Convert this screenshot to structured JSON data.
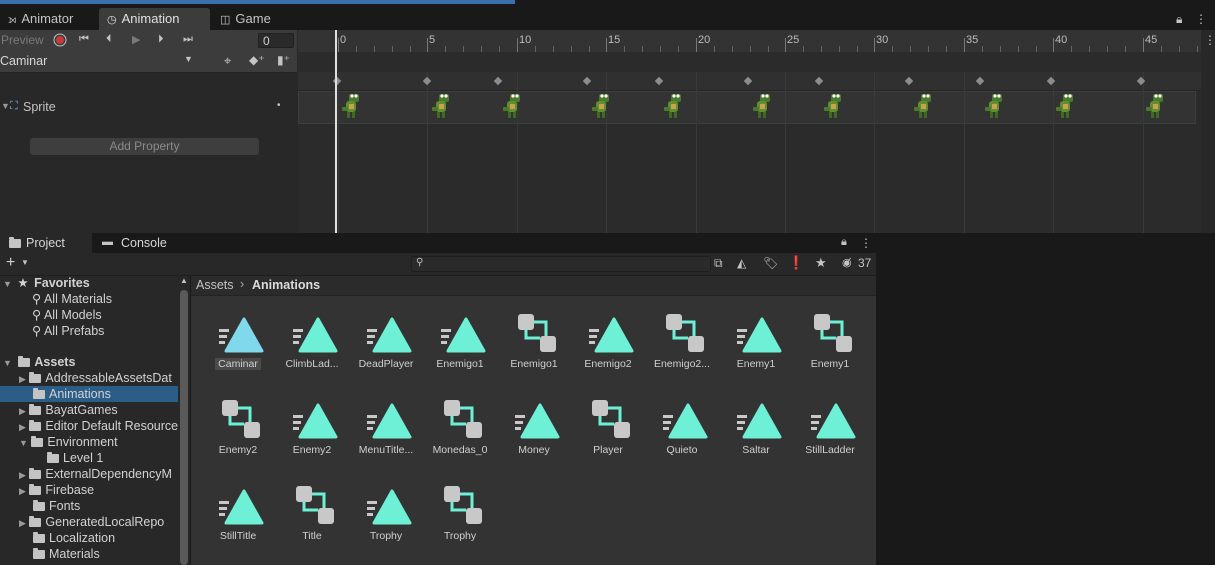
{
  "tabs": {
    "animator": "Animator",
    "animation": "Animation",
    "game": "Game"
  },
  "anim_toolbar": {
    "preview": "Preview",
    "frame_value": "0",
    "clip": "Caminar"
  },
  "anim_properties": {
    "sprite": "Sprite",
    "add_property": "Add Property"
  },
  "ruler_labels": [
    "0",
    "5",
    "10",
    "15",
    "20",
    "25",
    "30",
    "35",
    "40",
    "45"
  ],
  "project_tabs": {
    "project": "Project",
    "console": "Console"
  },
  "visible_count": "37",
  "breadcrumb": {
    "root": "Assets",
    "current": "Animations"
  },
  "tree": {
    "favorites": "Favorites",
    "fav_items": [
      "All Materials",
      "All Models",
      "All Prefabs"
    ],
    "assets": "Assets",
    "folders": [
      "AddressableAssetsDat",
      "Animations",
      "BayatGames",
      "Editor Default Resource",
      "Environment",
      "Level 1",
      "ExternalDependencyM",
      "Firebase",
      "Fonts",
      "GeneratedLocalRepo",
      "Localization",
      "Materials"
    ]
  },
  "assets": [
    {
      "name": "Caminar",
      "kind": "anim-clip-selected"
    },
    {
      "name": "ClimbLad...",
      "kind": "anim-clip"
    },
    {
      "name": "DeadPlayer",
      "kind": "anim-clip"
    },
    {
      "name": "Enemigo1",
      "kind": "anim-clip"
    },
    {
      "name": "Enemigo1",
      "kind": "controller"
    },
    {
      "name": "Enemigo2",
      "kind": "anim-clip"
    },
    {
      "name": "Enemigo2...",
      "kind": "controller"
    },
    {
      "name": "Enemy1",
      "kind": "anim-clip"
    },
    {
      "name": "Enemy1",
      "kind": "controller"
    },
    {
      "name": "Enemy2",
      "kind": "controller"
    },
    {
      "name": "Enemy2",
      "kind": "anim-clip"
    },
    {
      "name": "MenuTitle...",
      "kind": "anim-clip"
    },
    {
      "name": "Monedas_0",
      "kind": "controller"
    },
    {
      "name": "Money",
      "kind": "anim-clip"
    },
    {
      "name": "Player",
      "kind": "controller"
    },
    {
      "name": "Quieto",
      "kind": "anim-clip"
    },
    {
      "name": "Saltar",
      "kind": "anim-clip"
    },
    {
      "name": "StillLadder",
      "kind": "anim-clip"
    },
    {
      "name": "StillTitle",
      "kind": "anim-clip"
    },
    {
      "name": "Title",
      "kind": "controller"
    },
    {
      "name": "Trophy",
      "kind": "anim-clip"
    },
    {
      "name": "Trophy",
      "kind": "controller"
    }
  ],
  "colors": {
    "clip_icon": "#6ef0d6",
    "clip_icon_selected": "#7fd8ec",
    "selection": "#2c5d87",
    "accent": "#3a72b0"
  }
}
